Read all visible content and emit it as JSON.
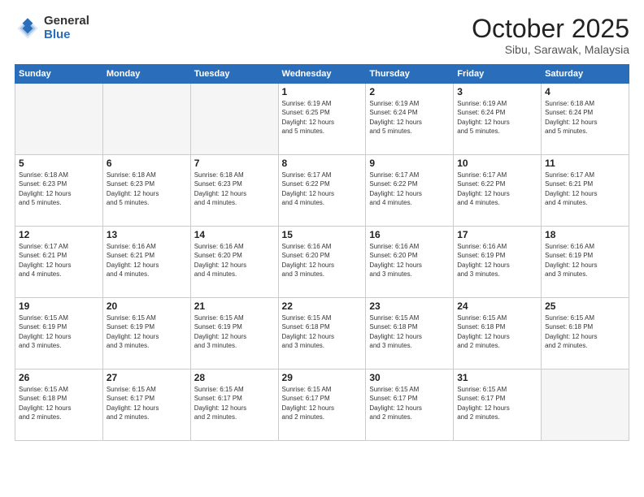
{
  "header": {
    "logo_general": "General",
    "logo_blue": "Blue",
    "month": "October 2025",
    "location": "Sibu, Sarawak, Malaysia"
  },
  "weekdays": [
    "Sunday",
    "Monday",
    "Tuesday",
    "Wednesday",
    "Thursday",
    "Friday",
    "Saturday"
  ],
  "weeks": [
    [
      {
        "day": "",
        "info": ""
      },
      {
        "day": "",
        "info": ""
      },
      {
        "day": "",
        "info": ""
      },
      {
        "day": "1",
        "info": "Sunrise: 6:19 AM\nSunset: 6:25 PM\nDaylight: 12 hours\nand 5 minutes."
      },
      {
        "day": "2",
        "info": "Sunrise: 6:19 AM\nSunset: 6:24 PM\nDaylight: 12 hours\nand 5 minutes."
      },
      {
        "day": "3",
        "info": "Sunrise: 6:19 AM\nSunset: 6:24 PM\nDaylight: 12 hours\nand 5 minutes."
      },
      {
        "day": "4",
        "info": "Sunrise: 6:18 AM\nSunset: 6:24 PM\nDaylight: 12 hours\nand 5 minutes."
      }
    ],
    [
      {
        "day": "5",
        "info": "Sunrise: 6:18 AM\nSunset: 6:23 PM\nDaylight: 12 hours\nand 5 minutes."
      },
      {
        "day": "6",
        "info": "Sunrise: 6:18 AM\nSunset: 6:23 PM\nDaylight: 12 hours\nand 5 minutes."
      },
      {
        "day": "7",
        "info": "Sunrise: 6:18 AM\nSunset: 6:23 PM\nDaylight: 12 hours\nand 4 minutes."
      },
      {
        "day": "8",
        "info": "Sunrise: 6:17 AM\nSunset: 6:22 PM\nDaylight: 12 hours\nand 4 minutes."
      },
      {
        "day": "9",
        "info": "Sunrise: 6:17 AM\nSunset: 6:22 PM\nDaylight: 12 hours\nand 4 minutes."
      },
      {
        "day": "10",
        "info": "Sunrise: 6:17 AM\nSunset: 6:22 PM\nDaylight: 12 hours\nand 4 minutes."
      },
      {
        "day": "11",
        "info": "Sunrise: 6:17 AM\nSunset: 6:21 PM\nDaylight: 12 hours\nand 4 minutes."
      }
    ],
    [
      {
        "day": "12",
        "info": "Sunrise: 6:17 AM\nSunset: 6:21 PM\nDaylight: 12 hours\nand 4 minutes."
      },
      {
        "day": "13",
        "info": "Sunrise: 6:16 AM\nSunset: 6:21 PM\nDaylight: 12 hours\nand 4 minutes."
      },
      {
        "day": "14",
        "info": "Sunrise: 6:16 AM\nSunset: 6:20 PM\nDaylight: 12 hours\nand 4 minutes."
      },
      {
        "day": "15",
        "info": "Sunrise: 6:16 AM\nSunset: 6:20 PM\nDaylight: 12 hours\nand 3 minutes."
      },
      {
        "day": "16",
        "info": "Sunrise: 6:16 AM\nSunset: 6:20 PM\nDaylight: 12 hours\nand 3 minutes."
      },
      {
        "day": "17",
        "info": "Sunrise: 6:16 AM\nSunset: 6:19 PM\nDaylight: 12 hours\nand 3 minutes."
      },
      {
        "day": "18",
        "info": "Sunrise: 6:16 AM\nSunset: 6:19 PM\nDaylight: 12 hours\nand 3 minutes."
      }
    ],
    [
      {
        "day": "19",
        "info": "Sunrise: 6:15 AM\nSunset: 6:19 PM\nDaylight: 12 hours\nand 3 minutes."
      },
      {
        "day": "20",
        "info": "Sunrise: 6:15 AM\nSunset: 6:19 PM\nDaylight: 12 hours\nand 3 minutes."
      },
      {
        "day": "21",
        "info": "Sunrise: 6:15 AM\nSunset: 6:19 PM\nDaylight: 12 hours\nand 3 minutes."
      },
      {
        "day": "22",
        "info": "Sunrise: 6:15 AM\nSunset: 6:18 PM\nDaylight: 12 hours\nand 3 minutes."
      },
      {
        "day": "23",
        "info": "Sunrise: 6:15 AM\nSunset: 6:18 PM\nDaylight: 12 hours\nand 3 minutes."
      },
      {
        "day": "24",
        "info": "Sunrise: 6:15 AM\nSunset: 6:18 PM\nDaylight: 12 hours\nand 2 minutes."
      },
      {
        "day": "25",
        "info": "Sunrise: 6:15 AM\nSunset: 6:18 PM\nDaylight: 12 hours\nand 2 minutes."
      }
    ],
    [
      {
        "day": "26",
        "info": "Sunrise: 6:15 AM\nSunset: 6:18 PM\nDaylight: 12 hours\nand 2 minutes."
      },
      {
        "day": "27",
        "info": "Sunrise: 6:15 AM\nSunset: 6:17 PM\nDaylight: 12 hours\nand 2 minutes."
      },
      {
        "day": "28",
        "info": "Sunrise: 6:15 AM\nSunset: 6:17 PM\nDaylight: 12 hours\nand 2 minutes."
      },
      {
        "day": "29",
        "info": "Sunrise: 6:15 AM\nSunset: 6:17 PM\nDaylight: 12 hours\nand 2 minutes."
      },
      {
        "day": "30",
        "info": "Sunrise: 6:15 AM\nSunset: 6:17 PM\nDaylight: 12 hours\nand 2 minutes."
      },
      {
        "day": "31",
        "info": "Sunrise: 6:15 AM\nSunset: 6:17 PM\nDaylight: 12 hours\nand 2 minutes."
      },
      {
        "day": "",
        "info": ""
      }
    ]
  ]
}
